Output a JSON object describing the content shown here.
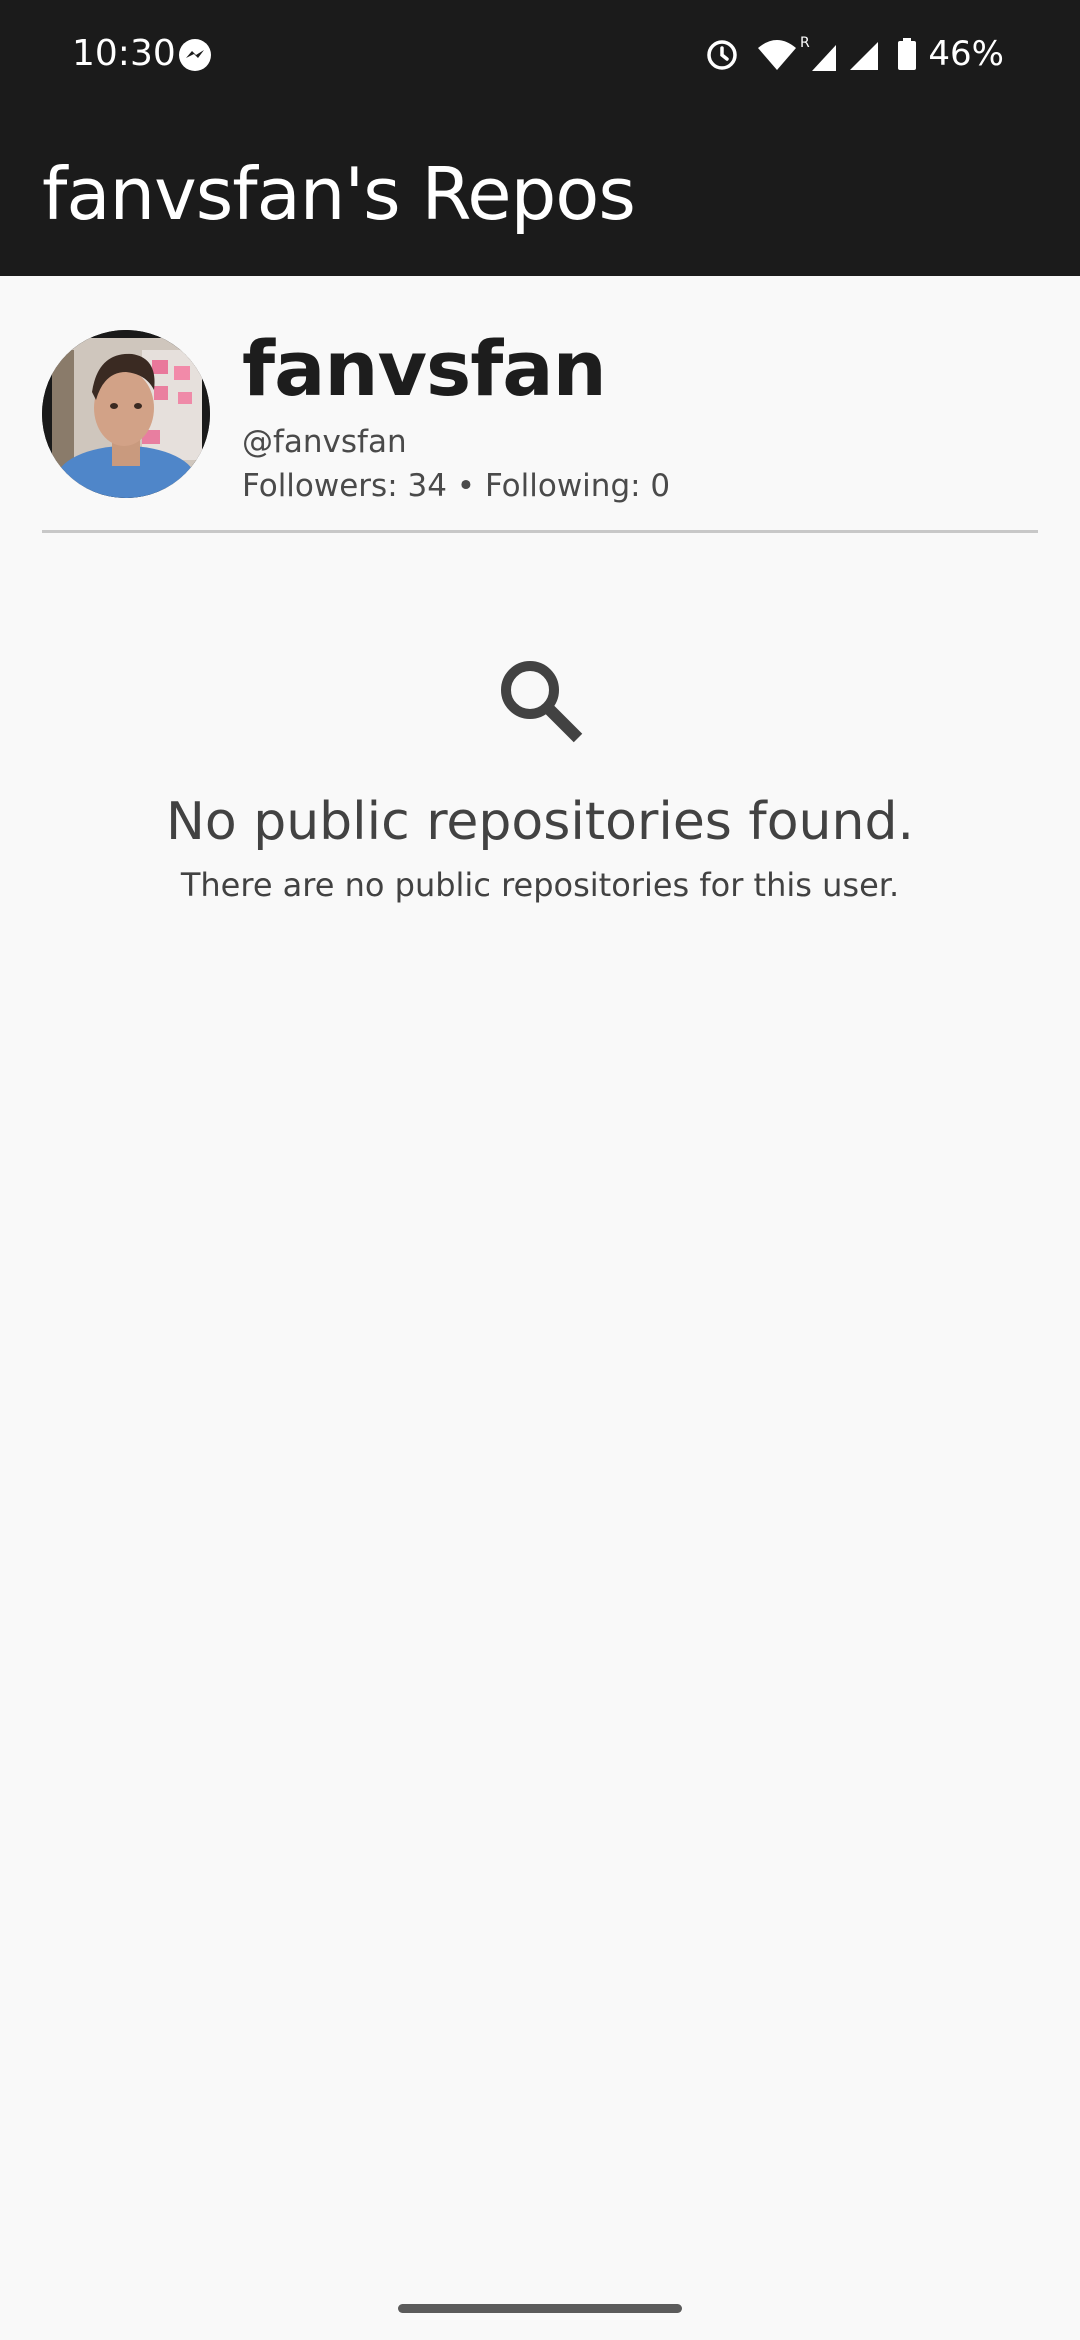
{
  "status_bar": {
    "time": "10:30",
    "battery": "46%",
    "icons": [
      "messenger-icon",
      "alarm-icon",
      "wifi-icon",
      "signal-r-icon",
      "signal-icon",
      "battery-icon"
    ]
  },
  "app_bar": {
    "title": "fanvsfan's Repos",
    "background": "#1b1b1b"
  },
  "profile": {
    "name": "fanvsfan",
    "handle": "@fanvsfan",
    "stats": "Followers: 34 • Following: 0"
  },
  "empty_state": {
    "icon": "search-icon",
    "title": "No public repositories found.",
    "subtitle": "There are no public repositories for this user."
  },
  "colors": {
    "page_background": "#f9f9f9",
    "text_dark": "#1d1d1d",
    "text_muted": "#424242"
  }
}
